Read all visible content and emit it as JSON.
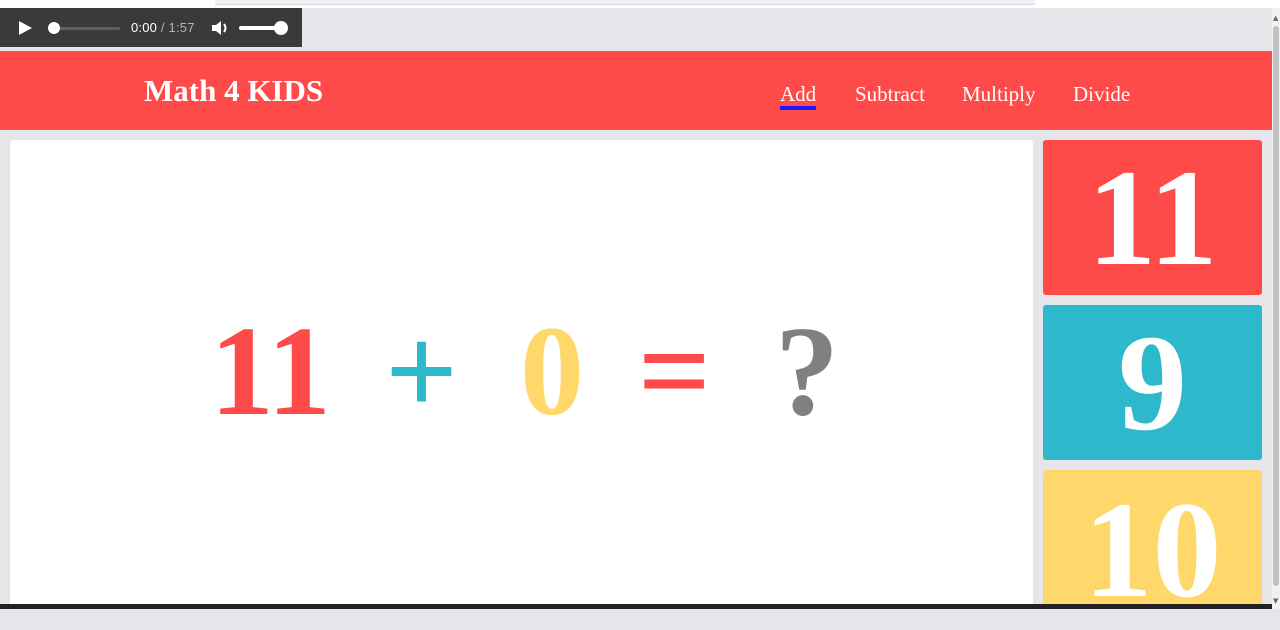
{
  "audio": {
    "current_time": "0:00",
    "separator": " / ",
    "duration": "1:57",
    "progress": 0,
    "volume": 1
  },
  "navbar": {
    "brand": "Math 4 KIDS",
    "items": [
      {
        "label": "Add",
        "active": true
      },
      {
        "label": "Subtract"
      },
      {
        "label": "Multiply"
      },
      {
        "label": "Divide"
      }
    ],
    "color": "#ff4a4a"
  },
  "equation": {
    "left": "11",
    "operator": "+",
    "right": "0",
    "equals": "=",
    "unknown": "?"
  },
  "answers": [
    {
      "value": "11",
      "color": "#ff4a4a"
    },
    {
      "value": "9",
      "color": "#2eb8cc"
    },
    {
      "value": "10",
      "color": "#ffd76a"
    }
  ]
}
